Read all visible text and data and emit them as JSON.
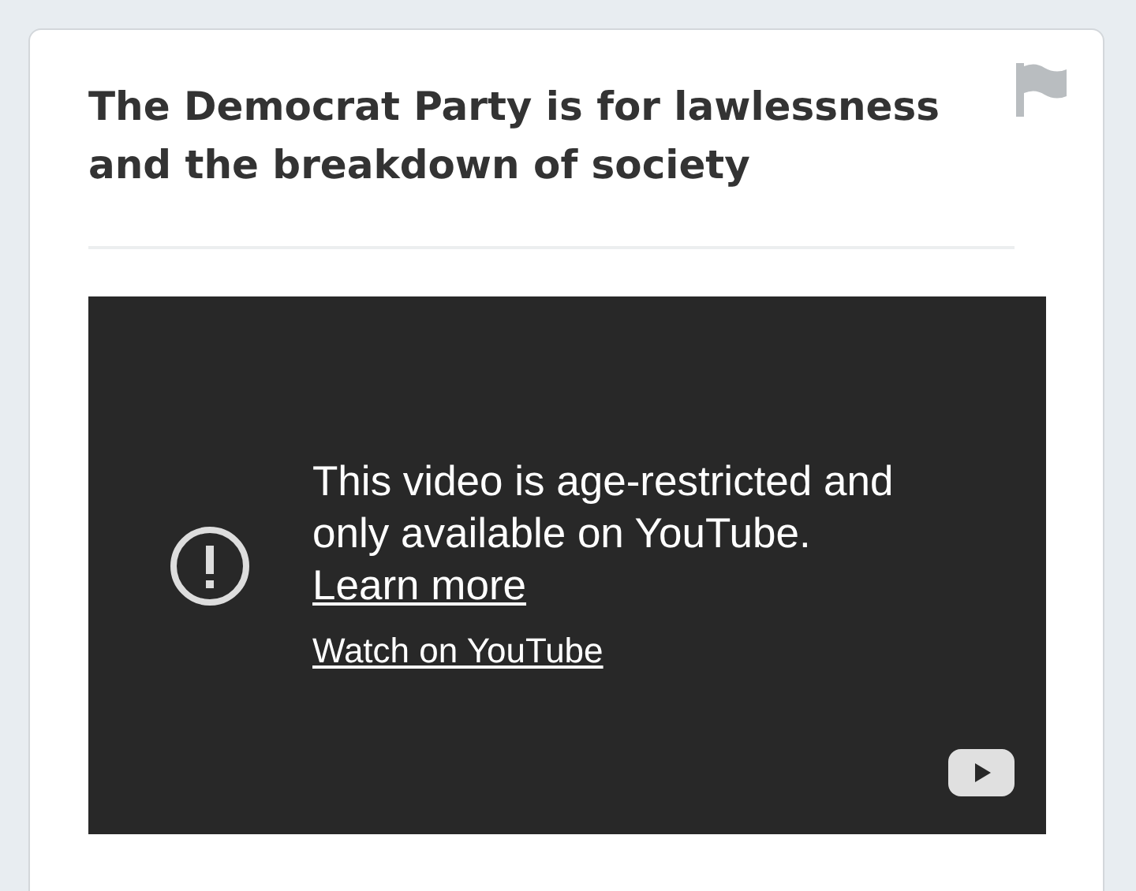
{
  "post": {
    "title": "The Democrat Party is for lawlessness and the breakdown of society"
  },
  "video": {
    "message": "This video is age-restricted and only available on YouTube.",
    "learn_more": "Learn more",
    "watch_link": "Watch on YouTube"
  }
}
